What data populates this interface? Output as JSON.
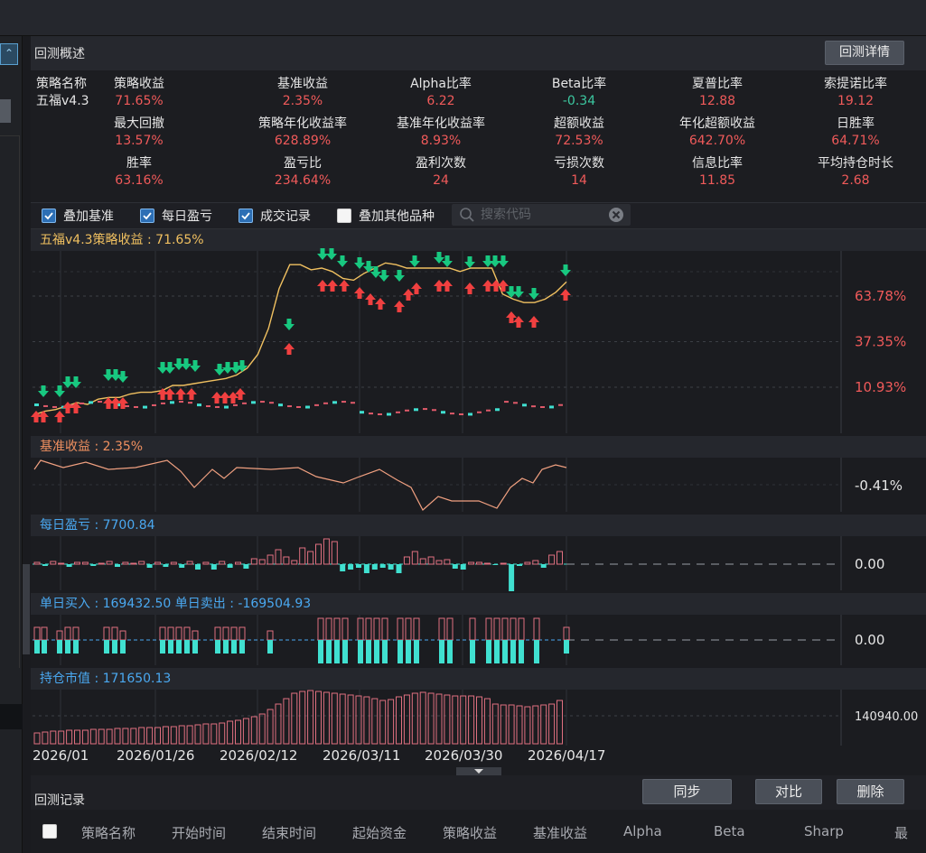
{
  "summary": {
    "title": "回测概述",
    "detail_button": "回测详情",
    "strategy_name_label": "策略名称",
    "strategy_name": "五福v4.3",
    "metrics": [
      {
        "label": "策略收益",
        "value": "71.65%",
        "color": "#f05a5a"
      },
      {
        "label": "基准收益",
        "value": "2.35%",
        "color": "#f05a5a"
      },
      {
        "label": "Alpha比率",
        "value": "6.22",
        "color": "#f05a5a"
      },
      {
        "label": "Beta比率",
        "value": "-0.34",
        "color": "#3cc8a0"
      },
      {
        "label": "夏普比率",
        "value": "12.88",
        "color": "#f05a5a"
      },
      {
        "label": "索提诺比率",
        "value": "19.12",
        "color": "#f05a5a"
      },
      {
        "label": "最大回撤",
        "value": "13.57%",
        "color": "#f05a5a"
      },
      {
        "label": "策略年化收益率",
        "value": "628.89%",
        "color": "#f05a5a"
      },
      {
        "label": "基准年化收益率",
        "value": "8.93%",
        "color": "#f05a5a"
      },
      {
        "label": "超额收益",
        "value": "72.53%",
        "color": "#f05a5a"
      },
      {
        "label": "年化超额收益",
        "value": "642.70%",
        "color": "#f05a5a"
      },
      {
        "label": "日胜率",
        "value": "64.71%",
        "color": "#f05a5a"
      },
      {
        "label": "胜率",
        "value": "63.16%",
        "color": "#f05a5a"
      },
      {
        "label": "盈亏比",
        "value": "234.64%",
        "color": "#f05a5a"
      },
      {
        "label": "盈利次数",
        "value": "24",
        "color": "#f05a5a"
      },
      {
        "label": "亏损次数",
        "value": "14",
        "color": "#f05a5a"
      },
      {
        "label": "信息比率",
        "value": "11.85",
        "color": "#f05a5a"
      },
      {
        "label": "平均持仓时长",
        "value": "2.68",
        "color": "#f05a5a"
      }
    ]
  },
  "options": {
    "overlay_benchmark": {
      "label": "叠加基准",
      "checked": true
    },
    "daily_pnl": {
      "label": "每日盈亏",
      "checked": true
    },
    "trades": {
      "label": "成交记录",
      "checked": true
    },
    "overlay_others": {
      "label": "叠加其他品种",
      "checked": false
    },
    "search_placeholder": "搜索代码"
  },
  "panels": {
    "strategy_title": "五福v4.3策略收益 : 71.65%",
    "benchmark_title": "基准收益 : 2.35%",
    "daily_pnl_title": "每日盈亏 : 7700.84",
    "buy_sell_title": "单日买入 : 169432.50  单日卖出 : -169504.93",
    "holding_title": "持仓市值 : 171650.13"
  },
  "colors": {
    "strategy_title": "#f0c060",
    "benchmark_title": "#f09060",
    "blue_title": "#4aa8f0",
    "red_label": "#f05a5a",
    "white_label": "#e6e6e6",
    "buy_arrow": "#f04040",
    "sell_arrow": "#18c880",
    "teal": "#40e0d0",
    "pink_bar": "#e07080"
  },
  "chart_data": [
    {
      "type": "line",
      "name": "strategy_returns",
      "x": [
        "2026/01",
        "2026/01/26",
        "2026/02/12",
        "2026/03/11",
        "2026/03/30",
        "2026/04/17"
      ],
      "values": [
        -5,
        -3,
        -2,
        0,
        2,
        1,
        4,
        5,
        5,
        7,
        8,
        8,
        9,
        12,
        12,
        13,
        14,
        15,
        16,
        18,
        22,
        30,
        45,
        68,
        82,
        82,
        79,
        80,
        78,
        74,
        73,
        77,
        80,
        83,
        82,
        80,
        80,
        80,
        80,
        80,
        78,
        80,
        80,
        80,
        65,
        62,
        60,
        60,
        62,
        66,
        72
      ],
      "y_tick_labels": [
        "63.78%",
        "37.35%",
        "10.93%"
      ],
      "y_ticks": [
        63.78,
        37.35,
        10.93
      ]
    },
    {
      "type": "line",
      "name": "benchmark_returns",
      "y_tick_labels": [
        "-0.41%"
      ],
      "y_ticks": [
        -0.41
      ]
    },
    {
      "type": "bar",
      "name": "daily_pnl",
      "y_tick_labels": [
        "0.00"
      ],
      "y_ticks": [
        0
      ]
    },
    {
      "type": "bar",
      "name": "daily_buy_sell",
      "y_tick_labels": [
        "0.00"
      ],
      "y_ticks": [
        0
      ]
    },
    {
      "type": "bar",
      "name": "holding_value",
      "y_tick_labels": [
        "140940.00"
      ],
      "y_ticks": [
        140940
      ],
      "x_tick_labels": [
        "2026/01",
        "2026/01/26",
        "2026/02/12",
        "2026/03/11",
        "2026/03/30",
        "2026/04/17"
      ]
    }
  ],
  "records": {
    "title": "回测记录",
    "sync_button": "同步",
    "compare_button": "对比",
    "delete_button": "删除",
    "columns": [
      "策略名称",
      "开始时间",
      "结束时间",
      "起始资金",
      "策略收益",
      "基准收益",
      "Alpha",
      "Beta",
      "Sharp",
      "最"
    ]
  }
}
